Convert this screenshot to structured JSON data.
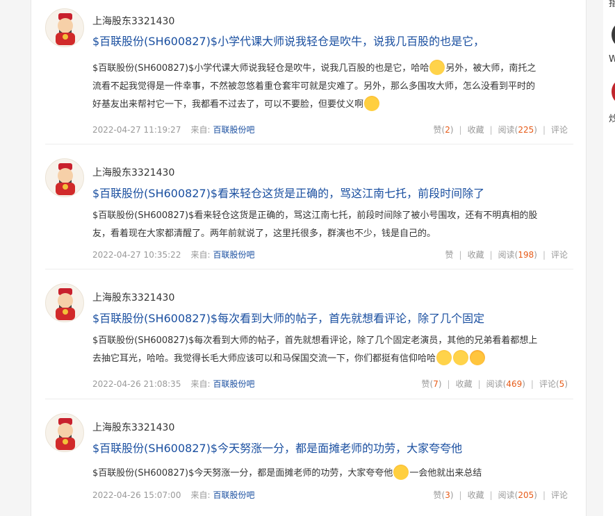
{
  "sidebar": {
    "items": [
      {
        "label": "指"
      },
      {
        "label": "W"
      },
      {
        "label": "炒"
      }
    ]
  },
  "labels": {
    "from": "来自:",
    "like": "赞",
    "collect": "收藏",
    "read": "阅读",
    "comment": "评论"
  },
  "posts": [
    {
      "username": "上海股东3321430",
      "title": "$百联股份(SH600827)$小学代课大师说我轻仓是吹牛，说我几百股的也是它，",
      "body_line1": "$百联股份(SH600827)$小学代课大师说我轻仓是吹牛，说我几百股的也是它，哈哈",
      "body_line1b": "另外，被大师，南托之",
      "body_line2": "流看不起我觉得是一件幸事，不然被忽悠着重仓套牢可就是灾难了。另外，那么多围攻大师，怎么没看到平时的",
      "body_line3": "好基友出来帮衬它一下，我都看不过去了，可以不要脸，但要仗义啊",
      "time": "2022-04-27 11:19:27",
      "source": "百联股份吧",
      "likes": "2",
      "reads": "225",
      "comments": ""
    },
    {
      "username": "上海股东3321430",
      "title": "$百联股份(SH600827)$看来轻仓这货是正确的，骂这江南七托，前段时间除了",
      "body_line1": "$百联股份(SH600827)$看来轻仓这货是正确的，骂这江南七托，前段时间除了被小号围攻，还有不明真相的股",
      "body_line2": "友，看着现在大家都清醒了。两年前就说了，这里托很多，群演也不少，钱是自己的。",
      "time": "2022-04-27 10:35:22",
      "source": "百联股份吧",
      "likes": "",
      "reads": "198",
      "comments": ""
    },
    {
      "username": "上海股东3321430",
      "title": "$百联股份(SH600827)$每次看到大师的帖子，首先就想看评论，除了几个固定",
      "body_line1": "$百联股份(SH600827)$每次看到大师的帖子，首先就想看评论，除了几个固定老演员，其他的兄弟看着都想上",
      "body_line2": "去抽它耳光，哈哈。我觉得长毛大师应该可以和马保国交流一下，你们都挺有信仰哈哈",
      "time": "2022-04-26 21:08:35",
      "source": "百联股份吧",
      "likes": "7",
      "reads": "469",
      "comments": "5"
    },
    {
      "username": "上海股东3321430",
      "title": "$百联股份(SH600827)$今天努涨一分，都是面摊老师的功劳，大家夸夸他",
      "body_line1": "$百联股份(SH600827)$今天努涨一分，都是面摊老师的功劳，大家夸夸他",
      "body_line1b": "一会他就出来总结",
      "time": "2022-04-26 15:07:00",
      "source": "百联股份吧",
      "likes": "3",
      "reads": "205",
      "comments": ""
    }
  ],
  "icons": {
    "avatar": "caishen-avatar-icon",
    "emoji_laugh": "laugh-tears-emoji-icon",
    "emoji_wink": "wink-emoji-icon",
    "emoji_grin": "grin-emoji-icon",
    "emoji_hug": "blush-emoji-icon"
  }
}
